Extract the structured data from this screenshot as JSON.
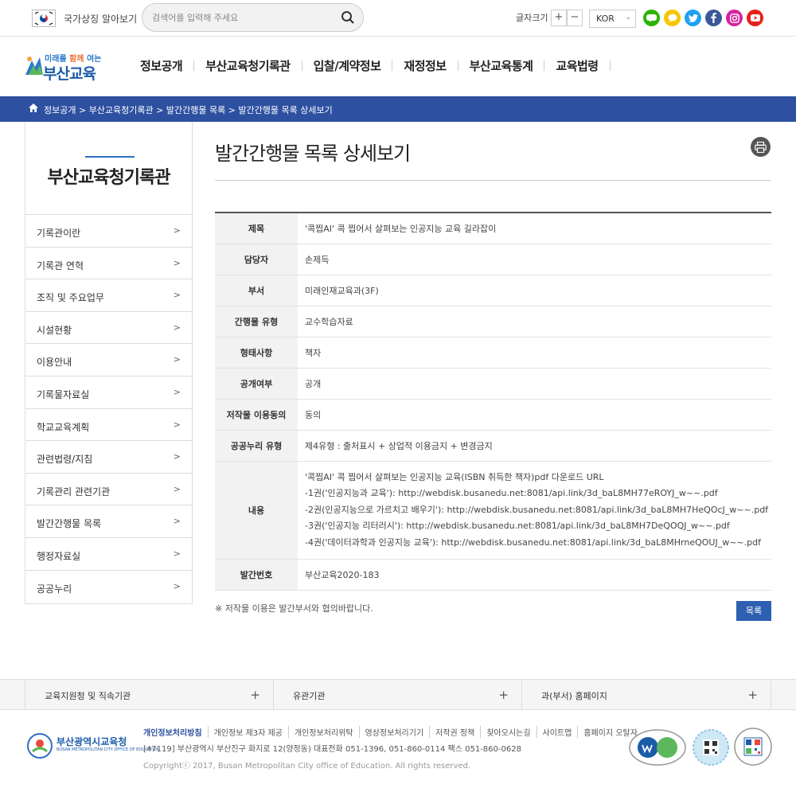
{
  "topbar": {
    "symbol_link": "국가상징 알아보기",
    "search_placeholder": "검색어를 입력해 주세요",
    "fontsize_label": "글자크기",
    "fontsize_plus": "+",
    "fontsize_minus": "−",
    "language": "KOR",
    "sns": [
      {
        "icon": "blog-icon",
        "color": "#2db400"
      },
      {
        "icon": "kakao-icon",
        "color": "#f7c600"
      },
      {
        "icon": "twitter-icon",
        "color": "#1da1f2"
      },
      {
        "icon": "facebook-icon",
        "color": "#3b5998"
      },
      {
        "icon": "instagram-icon",
        "color": "#d6249f"
      },
      {
        "icon": "youtube-icon",
        "color": "#e62117"
      }
    ]
  },
  "header": {
    "logo_small_1": "미래를 ",
    "logo_small_2": "함께",
    "logo_small_3": " 여는",
    "logo_big": "부산교육",
    "nav": [
      "정보공개",
      "부산교육청기록관",
      "입찰/계약정보",
      "재정정보",
      "부산교육통계",
      "교육법령"
    ]
  },
  "breadcrumb": "정보공개 > 부산교육청기록관 > 발간간행물 목록 > 발간간행물 목록 상세보기",
  "sidebar": {
    "title": "부산교육청기록관",
    "items": [
      "기록관이란",
      "기록관 연혁",
      "조직 및 주요업무",
      "시설현황",
      "이용안내",
      "기록물자료실",
      "학교교육계획",
      "관련법령/지침",
      "기록관리 관련기관",
      "발간간행물 목록",
      "행정자료실",
      "공공누리"
    ]
  },
  "content": {
    "title": "발간간행물 목록 상세보기",
    "rows": [
      {
        "label": "제목",
        "value": "'콕찝AI' 콕 찝어서 살펴보는 인공지능 교육 길라잡이"
      },
      {
        "label": "담당자",
        "value": "손제득"
      },
      {
        "label": "부서",
        "value": "미래인재교육과(3F)"
      },
      {
        "label": "간행물 유형",
        "value": "교수학습자료"
      },
      {
        "label": "형태사항",
        "value": "책자"
      },
      {
        "label": "공개여부",
        "value": "공개"
      },
      {
        "label": "저작물 이용동의",
        "value": "동의"
      },
      {
        "label": "공공누리 유형",
        "value": "제4유형 : 출처표시 + 상업적 이용금지 + 변경금지"
      }
    ],
    "content_label": "내용",
    "content_lines": [
      "'콕찝AI' 콕 찝어서 살펴보는 인공지능 교육(ISBN 취득한 책자)pdf 다운로드 URL",
      "-1권('인공지능과 교육'): http://webdisk.busanedu.net:8081/api.link/3d_baL8MH77eROYJ_w~~.pdf",
      "-2권(인공지능으로 가르치고 배우기'): http://webdisk.busanedu.net:8081/api.link/3d_baL8MH7HeQOcJ_w~~.pdf",
      "-3권('인공지능 리터러시'): http://webdisk.busanedu.net:8081/api.link/3d_baL8MH7DeQOQJ_w~~.pdf",
      "-4권('데이터과학과 인공지능 교육'): http://webdisk.busanedu.net:8081/api.link/3d_baL8MHrneQOUJ_w~~.pdf"
    ],
    "issue_label": "발간번호",
    "issue_value": "부산교육2020-183",
    "note": "※ 저작물 이용은 발간부서와 협의바랍니다.",
    "list_button": "목록"
  },
  "quicklinks": [
    "교육지원청 및 직속기관",
    "유관기관",
    "과(부서) 홈페이지"
  ],
  "footer": {
    "logo_title": "부산광역시교육청",
    "logo_sub": "BUSAN METROPOLITAN CITY OFFICE OF EDUCATION",
    "links": [
      "개인정보처리방침",
      "개인정보 제3자 제공",
      "개인정보처리위탁",
      "영상정보처리기기",
      "저작권 정책",
      "찾아오시는길",
      "사이트맵",
      "홈페이지 오탈자"
    ],
    "address": "[47119] 부산광역시 부산진구 화지로 12(양정동) 대표전화 051-1396, 051-860-0114 팩스 051-860-0628",
    "copyright": "Copyrightⓒ 2017, Busan Metropolitan City office of Education. All rights reserved."
  }
}
